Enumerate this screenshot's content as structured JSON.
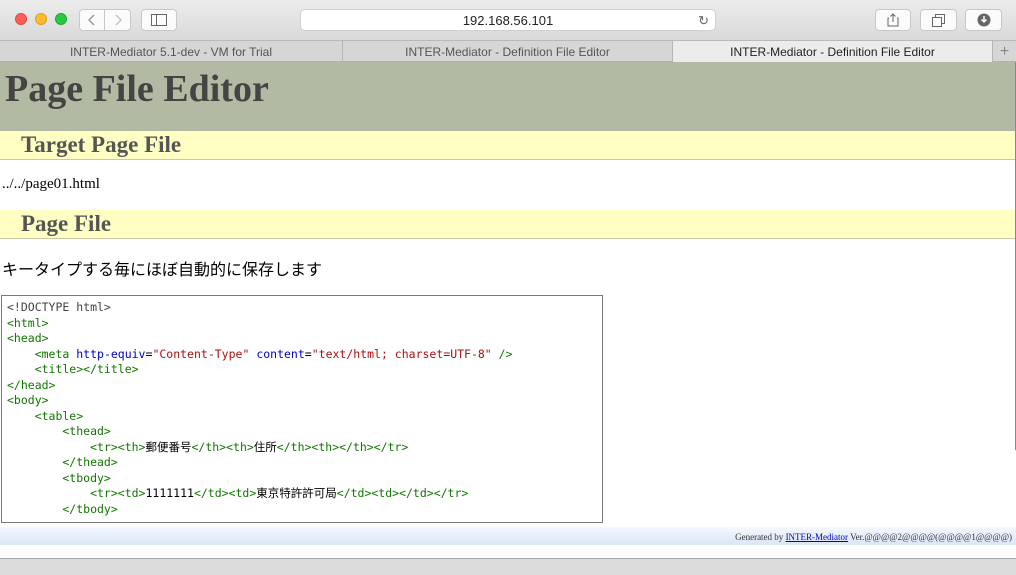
{
  "browser": {
    "url": "192.168.56.101",
    "tabs": [
      {
        "label": "INTER-Mediator 5.1-dev - VM for Trial"
      },
      {
        "label": "INTER-Mediator - Definition File Editor"
      },
      {
        "label": "INTER-Mediator - Definition File Editor"
      }
    ],
    "add_tab": "+"
  },
  "page": {
    "title": "Page File Editor",
    "target_section": "Target Page File",
    "target_path": "../../page01.html",
    "file_section": "Page File",
    "autosave_note": "キータイプする毎にほぼ自動的に保存します"
  },
  "editor": {
    "lines": [
      {
        "p": [
          "<!DOCTYPE html>"
        ]
      },
      {
        "p": [
          "<html>"
        ]
      },
      {
        "p": [
          "<head>"
        ]
      },
      {
        "p": [
          "    <meta ",
          "http-equiv",
          "=",
          "\"Content-Type\"",
          " ",
          "content",
          "=",
          "\"text/html; charset=UTF-8\"",
          " />"
        ]
      },
      {
        "p": [
          "    <title></title>"
        ]
      },
      {
        "p": [
          "</head>"
        ]
      },
      {
        "p": [
          "<body>"
        ]
      },
      {
        "p": [
          "    <table>"
        ]
      },
      {
        "p": [
          "        <thead>"
        ]
      },
      {
        "p": [
          "            <tr><th>",
          "郵便番号",
          "</th><th>",
          "住所",
          "</th><th></th></tr>"
        ]
      },
      {
        "p": [
          "        </thead>"
        ]
      },
      {
        "p": [
          "        <tbody>"
        ]
      },
      {
        "p": [
          "            <tr><td>",
          "1111111",
          "</td><td>",
          "東京特許許可局",
          "</td><td></td></tr>"
        ]
      },
      {
        "p": [
          "        </tbody>"
        ]
      }
    ]
  },
  "footer": {
    "prefix": "Generated by ",
    "link": "INTER-Mediator",
    "version": " Ver.@@@@2@@@@(@@@@1@@@@)"
  }
}
